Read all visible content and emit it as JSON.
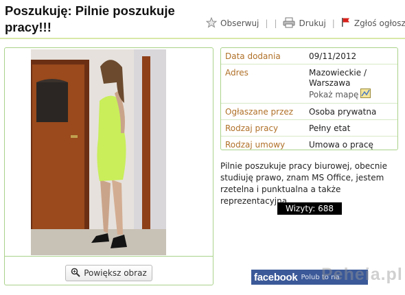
{
  "header": {
    "title": "Poszukuję: Pilnie poszukuje pracy!!!",
    "observe_label": "Obserwuj",
    "print_label": "Drukuj",
    "report_label": "Zgłoś ogłoszenie",
    "separator": "|"
  },
  "icons": {
    "observe": "star-icon",
    "print": "printer-icon",
    "report": "red-flag-icon",
    "zoom": "magnifier-icon",
    "map": "map-icon"
  },
  "details": {
    "rows": [
      {
        "label": "Data dodania",
        "value": "09/11/2012"
      },
      {
        "label": "Adres",
        "value": "Mazowieckie / Warszawa",
        "link": "Pokaż mapę"
      },
      {
        "label": "Ogłaszane przez",
        "value": "Osoba prywatna"
      },
      {
        "label": "Rodzaj pracy",
        "value": "Pełny etat"
      },
      {
        "label": "Rodzaj umowy",
        "value": "Umowa o pracę"
      }
    ]
  },
  "description": "Pilnie poszukuje pracy biurowej, obecnie studiuję prawo, znam MS Office, jestem rzetelna i punktualna a także reprezentacyjna.",
  "visits": "Wizyty: 688",
  "image": {
    "zoom_label": "Powiększ obraz"
  },
  "facebook": {
    "brand": "facebook",
    "tag": "Polub to na"
  },
  "watermark": "Peheia.pl",
  "colors": {
    "label_orange": "#b07028",
    "panel_border": "#a9d28a",
    "header_line": "#d8e8a8",
    "facebook_blue": "#3b5998",
    "dress": "#c9ee5a"
  }
}
